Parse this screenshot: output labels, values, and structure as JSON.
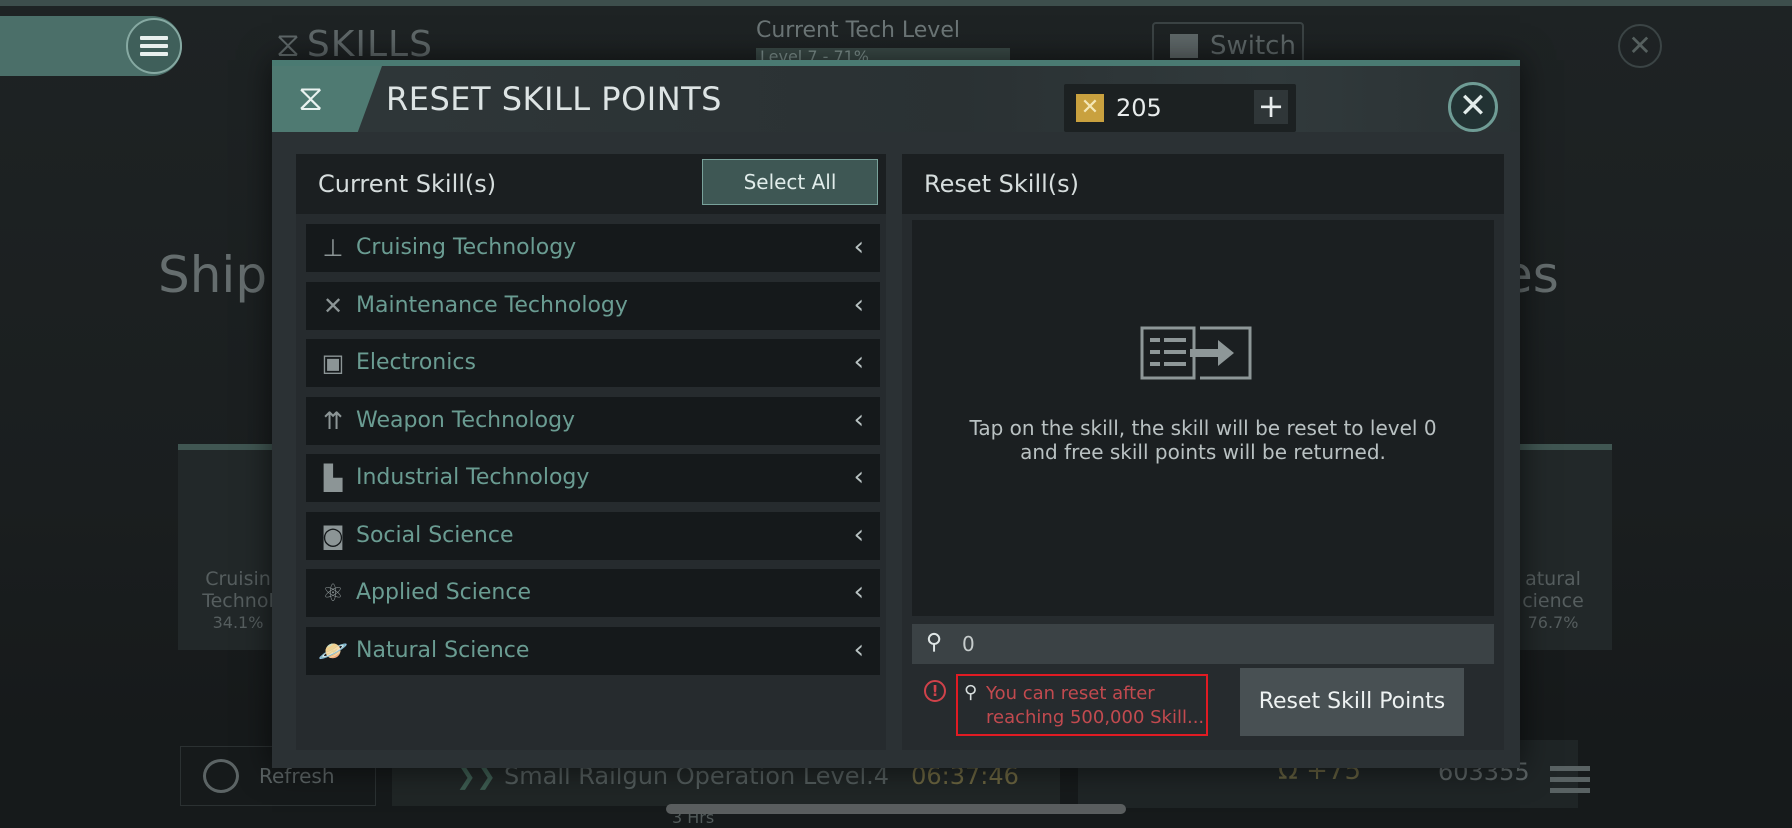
{
  "background": {
    "title": "SKILLS",
    "tech_label": "Current Tech Level",
    "tech_value": "Level 7 - 71%",
    "switch_label": "Switch",
    "left_heading": "Ship",
    "right_heading": "es",
    "left_card": {
      "line1": "Cruisin",
      "line2": "Technol",
      "pct": "34.1%"
    },
    "right_card": {
      "line1": "atural",
      "line2": "cience",
      "pct": "76.7%"
    },
    "refresh_label": "Refresh",
    "queue_text": "Small Railgun Operation Level.4",
    "queue_time": "06:37:46",
    "queue_sub": "3 Hrs",
    "bonus": "+75",
    "skill_points_total": "603355"
  },
  "modal": {
    "title": "RESET SKILL POINTS",
    "currency_amount": "205",
    "currency_add": "+",
    "close_glyph": "✕",
    "left_panel": {
      "header": "Current Skill(s)",
      "select_all": "Select All",
      "skills": [
        {
          "label": "Cruising Technology",
          "icon": "cruising-icon"
        },
        {
          "label": "Maintenance Technology",
          "icon": "tools-icon"
        },
        {
          "label": "Electronics",
          "icon": "chip-icon"
        },
        {
          "label": "Weapon Technology",
          "icon": "missile-icon"
        },
        {
          "label": "Industrial Technology",
          "icon": "factory-icon"
        },
        {
          "label": "Social Science",
          "icon": "social-icon"
        },
        {
          "label": "Applied Science",
          "icon": "atom-icon"
        },
        {
          "label": "Natural Science",
          "icon": "planet-icon"
        }
      ]
    },
    "right_panel": {
      "header": "Reset Skill(s)",
      "hint_line1": "Tap on the skill, the skill will be reset to level 0",
      "hint_line2": "and free skill points will be returned.",
      "points_value": "0",
      "warning_line1": "You can reset after",
      "warning_line2": "reaching 500,000 Skill...",
      "reset_button": "Reset Skill Points"
    }
  },
  "colors": {
    "accent": "#4f7a72",
    "skill_text": "#6a9c92",
    "warning": "#c24a4f",
    "warning_border": "#e01b23",
    "currency_coin": "#c9a13f"
  }
}
